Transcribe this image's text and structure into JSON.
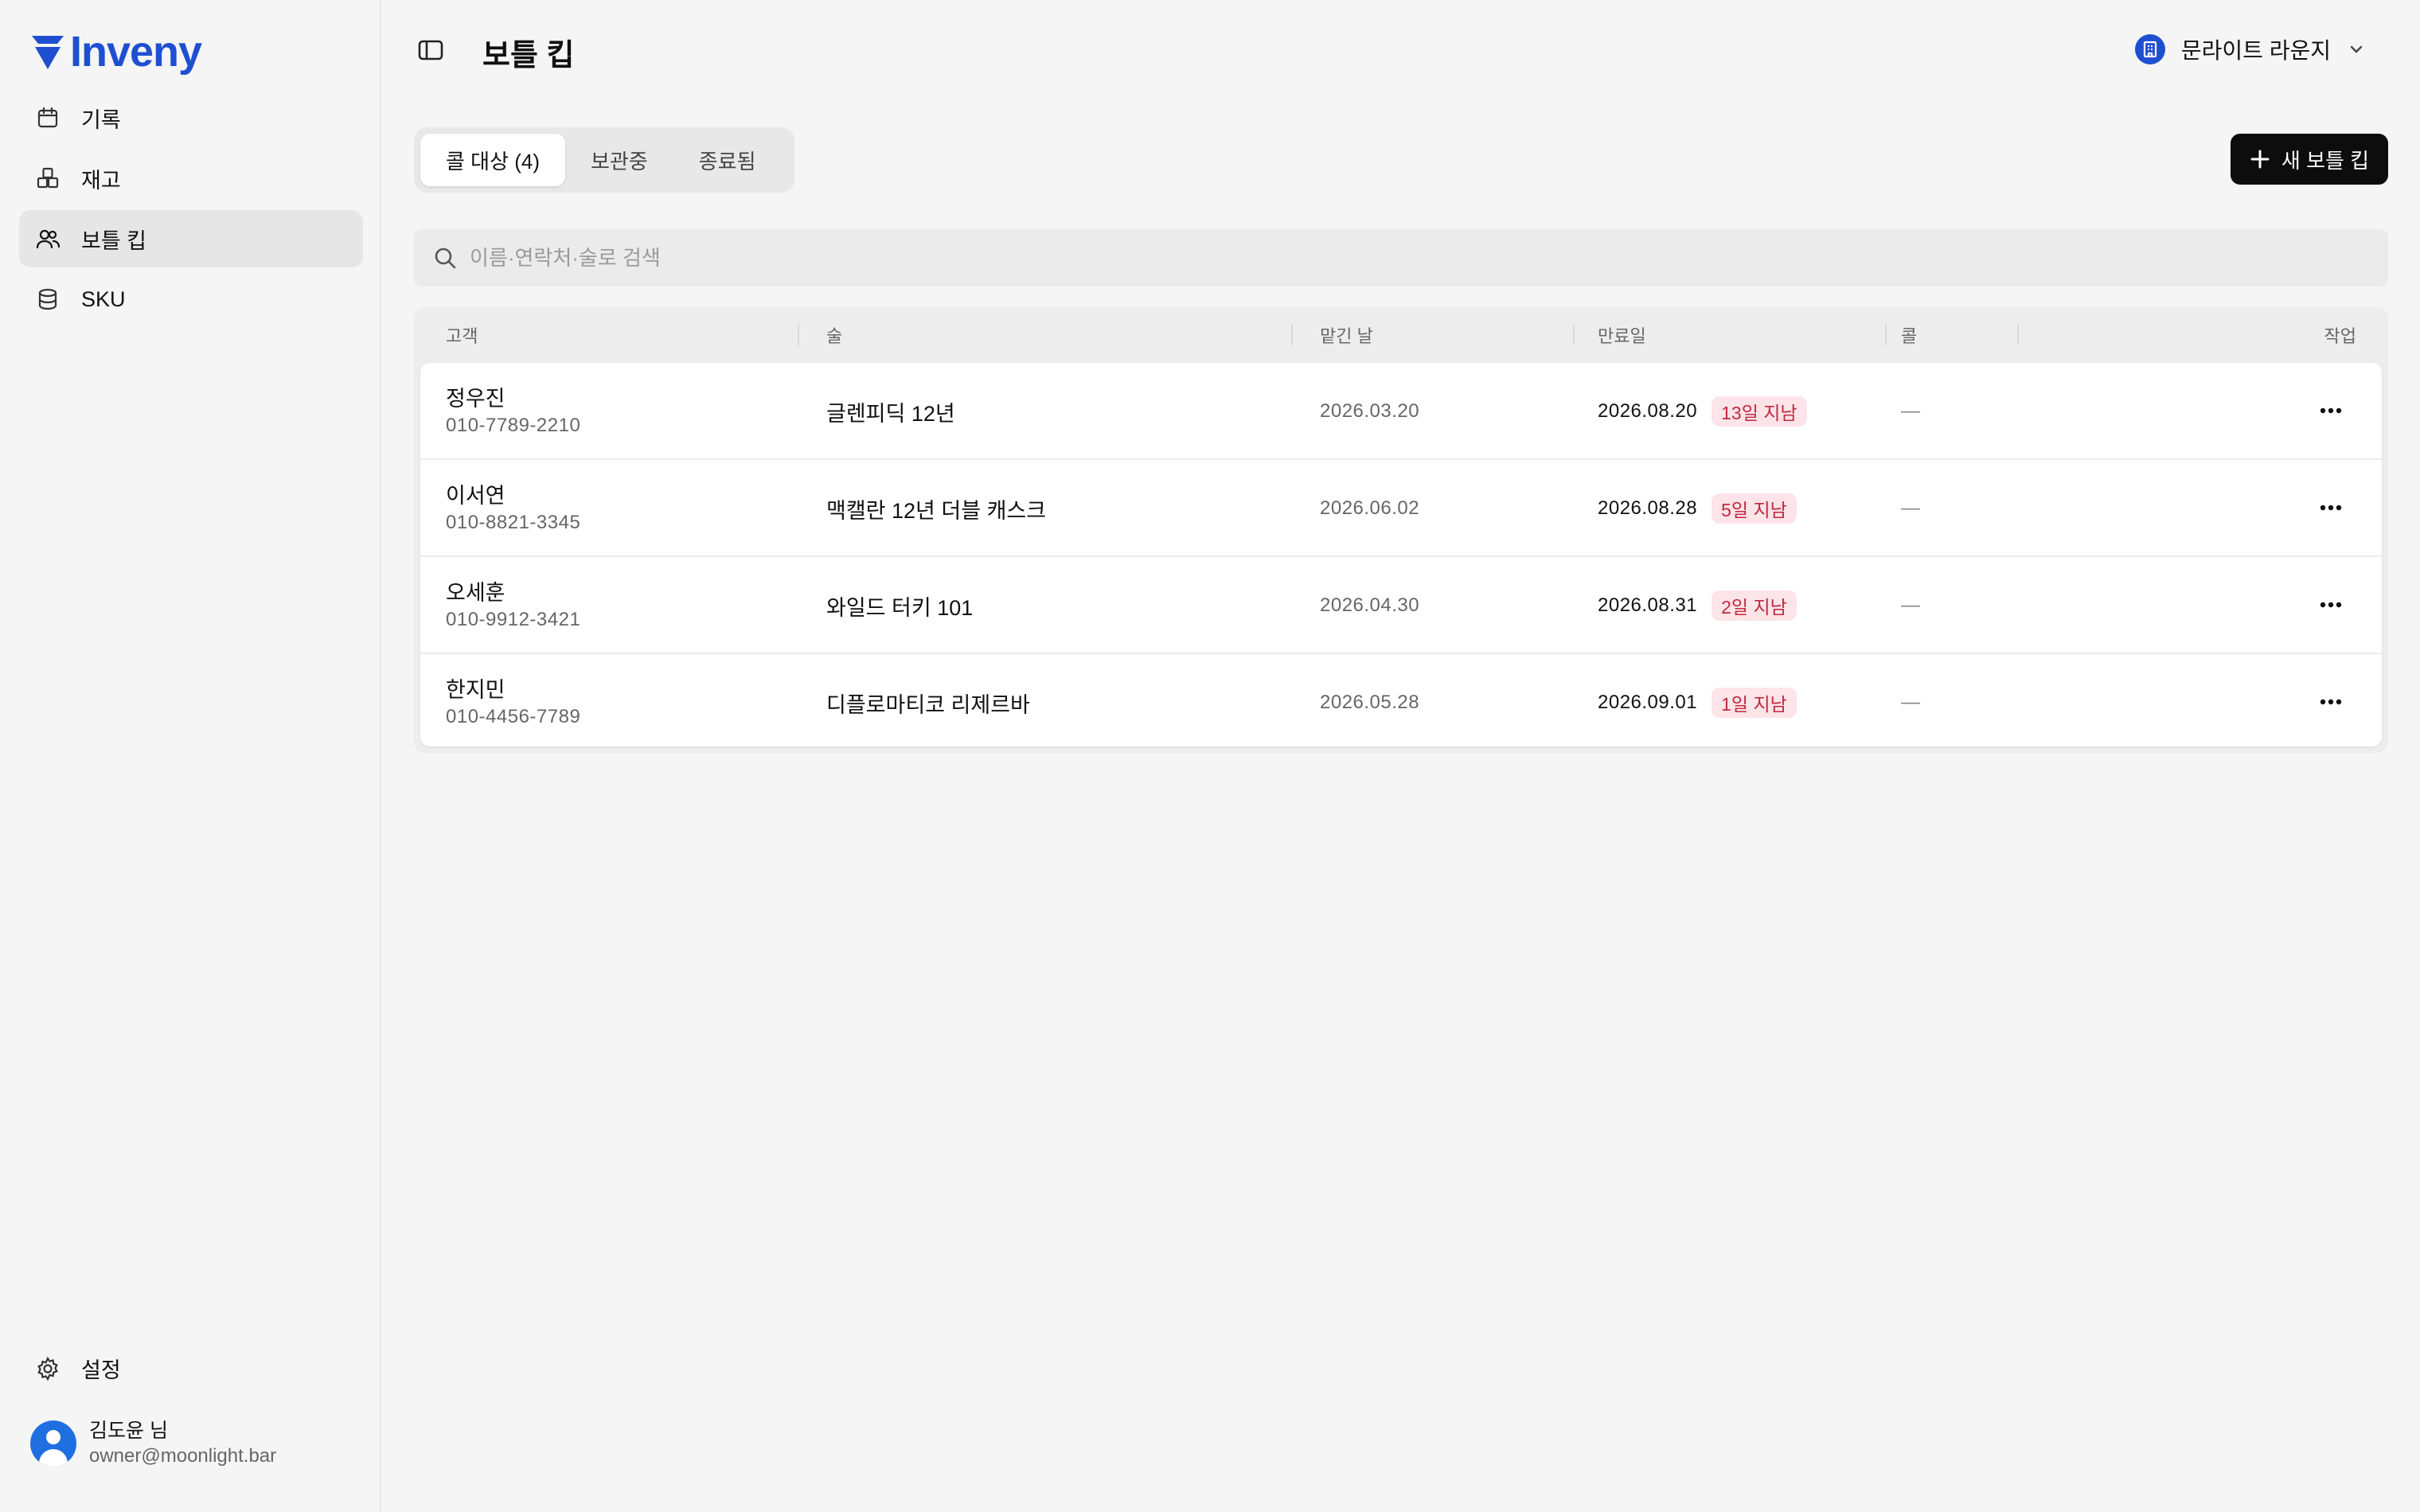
{
  "brand": {
    "name": "Inveny",
    "color": "#1f4fd1"
  },
  "sidebar": {
    "items": [
      {
        "label": "기록",
        "icon": "calendar-icon",
        "active": false
      },
      {
        "label": "재고",
        "icon": "boxes-icon",
        "active": false
      },
      {
        "label": "보틀 킵",
        "icon": "users-icon",
        "active": true
      },
      {
        "label": "SKU",
        "icon": "database-icon",
        "active": false
      }
    ],
    "settings_label": "설정",
    "user": {
      "name": "김도윤 님",
      "email": "owner@moonlight.bar"
    }
  },
  "header": {
    "title": "보틀 킵",
    "workspace": "문라이트 라운지"
  },
  "tabs": [
    {
      "label": "콜 대상 (4)",
      "active": true
    },
    {
      "label": "보관중",
      "active": false
    },
    {
      "label": "종료됨",
      "active": false
    }
  ],
  "new_button_label": "새 보틀 킵",
  "search": {
    "placeholder": "이름·연락처·술로 검색"
  },
  "table": {
    "columns": [
      "고객",
      "술",
      "맡긴 날",
      "만료일",
      "콜",
      "작업"
    ],
    "rows": [
      {
        "name": "정우진",
        "phone": "010-7789-2210",
        "liquor": "글렌피딕 12년",
        "deposited": "2026.03.20",
        "expiry": "2026.08.20",
        "overdue": "13일 지남",
        "call": "—"
      },
      {
        "name": "이서연",
        "phone": "010-8821-3345",
        "liquor": "맥캘란 12년 더블 캐스크",
        "deposited": "2026.06.02",
        "expiry": "2026.08.28",
        "overdue": "5일 지남",
        "call": "—"
      },
      {
        "name": "오세훈",
        "phone": "010-9912-3421",
        "liquor": "와일드 터키 101",
        "deposited": "2026.04.30",
        "expiry": "2026.08.31",
        "overdue": "2일 지남",
        "call": "—"
      },
      {
        "name": "한지민",
        "phone": "010-4456-7789",
        "liquor": "디플로마티코 리제르바",
        "deposited": "2026.05.28",
        "expiry": "2026.09.01",
        "overdue": "1일 지남",
        "call": "—"
      }
    ]
  },
  "colors": {
    "overdue_badge_bg": "#fce4e8",
    "overdue_badge_text": "#c0293f",
    "primary_button": "#0d0d0d"
  }
}
